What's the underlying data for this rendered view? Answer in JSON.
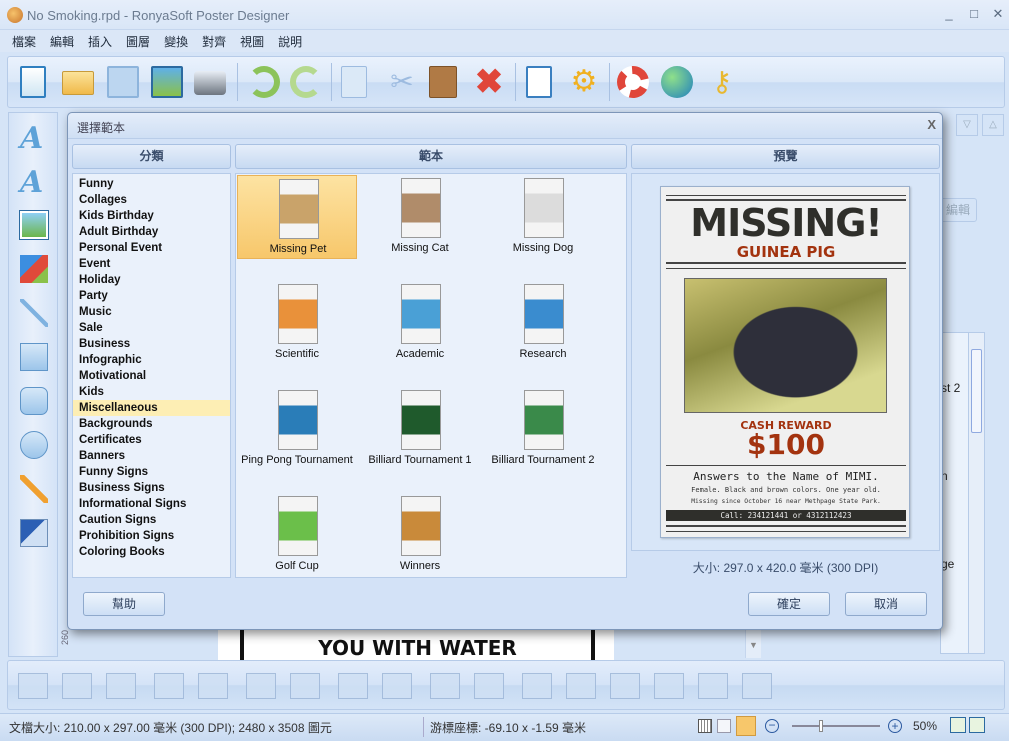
{
  "window": {
    "title": "No Smoking.rpd - RonyaSoft Poster Designer"
  },
  "menu": [
    "檔案",
    "編輯",
    "插入",
    "圖層",
    "變換",
    "對齊",
    "視圖",
    "說明"
  ],
  "toolbar": {
    "icons": [
      "new-document-icon",
      "open-folder-icon",
      "save-icon",
      "export-image-icon",
      "print-icon",
      "undo-icon",
      "redo-icon",
      "copy-icon",
      "cut-icon",
      "paste-icon",
      "delete-icon",
      "page-settings-icon",
      "preferences-gear-icon",
      "help-lifebuoy-icon",
      "website-globe-icon",
      "register-key-icon"
    ]
  },
  "left_tools": [
    "text-icon",
    "art-text-icon",
    "image-icon",
    "clipart-icon",
    "line-icon",
    "rectangle-icon",
    "rounded-rectangle-icon",
    "ellipse-icon",
    "pencil-icon",
    "office-import-icon"
  ],
  "background": {
    "canvas_text": "YOU WITH WATER",
    "ruler_value": "260",
    "right_partial": [
      "編輯",
      "st 2",
      "n",
      "ge"
    ]
  },
  "dialog": {
    "title": "選擇範本",
    "close": "X",
    "headers": {
      "categories": "分類",
      "templates": "範本",
      "preview": "預覽"
    },
    "categories": [
      "Funny",
      "Collages",
      "Kids Birthday",
      "Adult Birthday",
      "Personal Event",
      "Event",
      "Holiday",
      "Party",
      "Music",
      "Sale",
      "Business",
      "Infographic",
      "Motivational",
      "Kids",
      "Miscellaneous",
      "Backgrounds",
      "Certificates",
      "Banners",
      "Funny Signs",
      "Business Signs",
      "Informational Signs",
      "Caution Signs",
      "Prohibition Signs",
      "Coloring Books"
    ],
    "selected_category": "Miscellaneous",
    "templates": [
      {
        "label": "Missing Pet",
        "color": "#c9a36a",
        "selected": true
      },
      {
        "label": "Missing Cat",
        "color": "#b08c6a"
      },
      {
        "label": "Missing Dog",
        "color": "#dcdcdc"
      },
      {
        "label": "Scientific",
        "color": "#e9913a"
      },
      {
        "label": "Academic",
        "color": "#4aa0d6"
      },
      {
        "label": "Research",
        "color": "#3a8ccf"
      },
      {
        "label": "Ping Pong Tournament",
        "color": "#2a7db8"
      },
      {
        "label": "Billiard Tournament 1",
        "color": "#1f5a2c"
      },
      {
        "label": "Billiard Tournament 2",
        "color": "#3a8a4a"
      },
      {
        "label": "Golf Cup",
        "color": "#6bbf4a"
      },
      {
        "label": "Winners",
        "color": "#c98a3a"
      }
    ],
    "preview": {
      "headline": "MISSING!",
      "subhead": "GUINEA PIG",
      "reward_label": "CASH REWARD",
      "reward_amount": "$100",
      "line1": "Answers to the Name of MIMI.",
      "line2": "Female. Black and brown colors. One year old.",
      "line3": "Missing since October 16 near Methpage State Park.",
      "call": "Call: 234121441 or 4312112423"
    },
    "size": "大小: 297.0 x 420.0 毫米 (300 DPI)",
    "buttons": {
      "help": "幫助",
      "ok": "確定",
      "cancel": "取消"
    }
  },
  "status": {
    "doc_size": "文檔大小: 210.00 x 297.00 毫米 (300 DPI); 2480 x 3508 圖元",
    "cursor": "游標座標: -69.10 x -1.59 毫米",
    "zoom": "50%",
    "zoom_level": 50
  },
  "colors": {
    "accent": "#f7c76b",
    "poster_red": "#a3330f",
    "poster_dark": "#2f2f2b"
  }
}
